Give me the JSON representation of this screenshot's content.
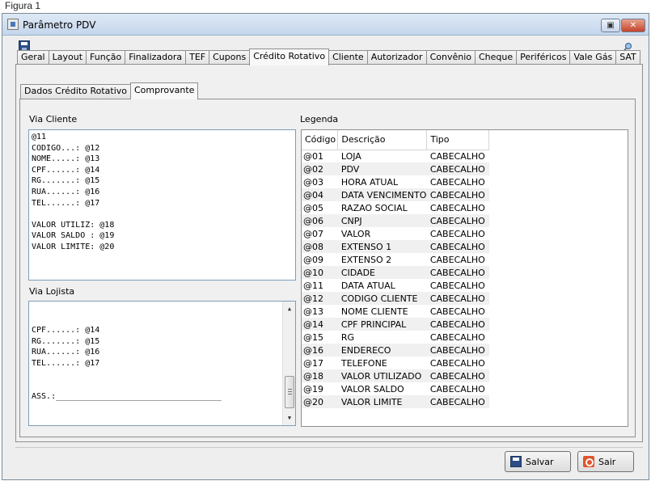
{
  "figure_caption": "Figura 1",
  "window": {
    "title": "Parâmetro PDV",
    "restore_glyph": "▣",
    "close_glyph": "✕"
  },
  "toolbar": {
    "save_icon": "save-icon",
    "key_icon": "key-icon"
  },
  "main_tabs": [
    "Geral",
    "Layout",
    "Função",
    "Finalizadora",
    "TEF",
    "Cupons",
    "Crédito Rotativo",
    "Cliente",
    "Autorizador",
    "Convênio",
    "Cheque",
    "Periféricos",
    "Vale Gás",
    "SAT"
  ],
  "active_main_tab": "Crédito Rotativo",
  "sub_tabs": [
    "Dados Crédito Rotativo",
    "Comprovante"
  ],
  "active_sub_tab": "Comprovante",
  "via_cliente": {
    "label": "Via Cliente",
    "text": "@11\nCODIGO...: @12\nNOME.....: @13\nCPF......: @14\nRG.......: @15\nRUA......: @16\nTEL......: @17\n\nVALOR UTILIZ: @18\nVALOR SALDO : @19\nVALOR LIMITE: @20"
  },
  "via_lojista": {
    "label": "Via Lojista",
    "text": "CPF......: @14\nRG.......: @15\nRUA......: @16\nTEL......: @17\n\n\nASS.:__________________________________",
    "scroll_up": "▲",
    "scroll_down": "▼"
  },
  "legenda": {
    "label": "Legenda",
    "columns": [
      "Código",
      "Descrição",
      "Tipo"
    ],
    "rows": [
      [
        "@01",
        "LOJA",
        "CABECALHO"
      ],
      [
        "@02",
        "PDV",
        "CABECALHO"
      ],
      [
        "@03",
        "HORA ATUAL",
        "CABECALHO"
      ],
      [
        "@04",
        "DATA VENCIMENTO",
        "CABECALHO"
      ],
      [
        "@05",
        "RAZAO SOCIAL",
        "CABECALHO"
      ],
      [
        "@06",
        "CNPJ",
        "CABECALHO"
      ],
      [
        "@07",
        "VALOR",
        "CABECALHO"
      ],
      [
        "@08",
        "EXTENSO 1",
        "CABECALHO"
      ],
      [
        "@09",
        "EXTENSO 2",
        "CABECALHO"
      ],
      [
        "@10",
        "CIDADE",
        "CABECALHO"
      ],
      [
        "@11",
        "DATA ATUAL",
        "CABECALHO"
      ],
      [
        "@12",
        "CODIGO CLIENTE",
        "CABECALHO"
      ],
      [
        "@13",
        "NOME CLIENTE",
        "CABECALHO"
      ],
      [
        "@14",
        "CPF PRINCIPAL",
        "CABECALHO"
      ],
      [
        "@15",
        "RG",
        "CABECALHO"
      ],
      [
        "@16",
        "ENDERECO",
        "CABECALHO"
      ],
      [
        "@17",
        "TELEFONE",
        "CABECALHO"
      ],
      [
        "@18",
        "VALOR UTILIZADO",
        "CABECALHO"
      ],
      [
        "@19",
        "VALOR SALDO",
        "CABECALHO"
      ],
      [
        "@20",
        "VALOR LIMITE",
        "CABECALHO"
      ]
    ]
  },
  "buttons": {
    "salvar": "Salvar",
    "sair": "Sair"
  }
}
